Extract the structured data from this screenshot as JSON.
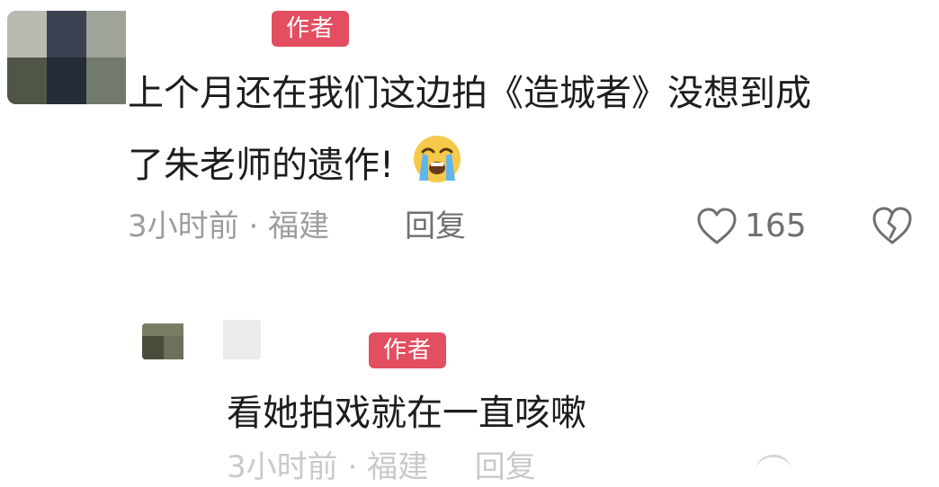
{
  "main_comment": {
    "author_tag": "作者",
    "text_line_1": "上个月还在我们这边拍《造城者》没想到成",
    "text_line_2": "了朱老师的遗作!",
    "emoji_icon": "loudly-crying-face-icon",
    "time": "3小时前",
    "separator": "·",
    "location": "福建",
    "reply_label": "回复",
    "like_count": "165"
  },
  "reply_comment": {
    "author_tag": "作者",
    "text": "看她拍戏就在一直咳嗽",
    "time": "3小时前",
    "separator": "·",
    "location": "福建",
    "reply_label": "回复"
  },
  "colors": {
    "author_tag_bg": "#e24f60",
    "meta_gray": "#9d9da1",
    "text_dark": "#1d1d1f"
  }
}
